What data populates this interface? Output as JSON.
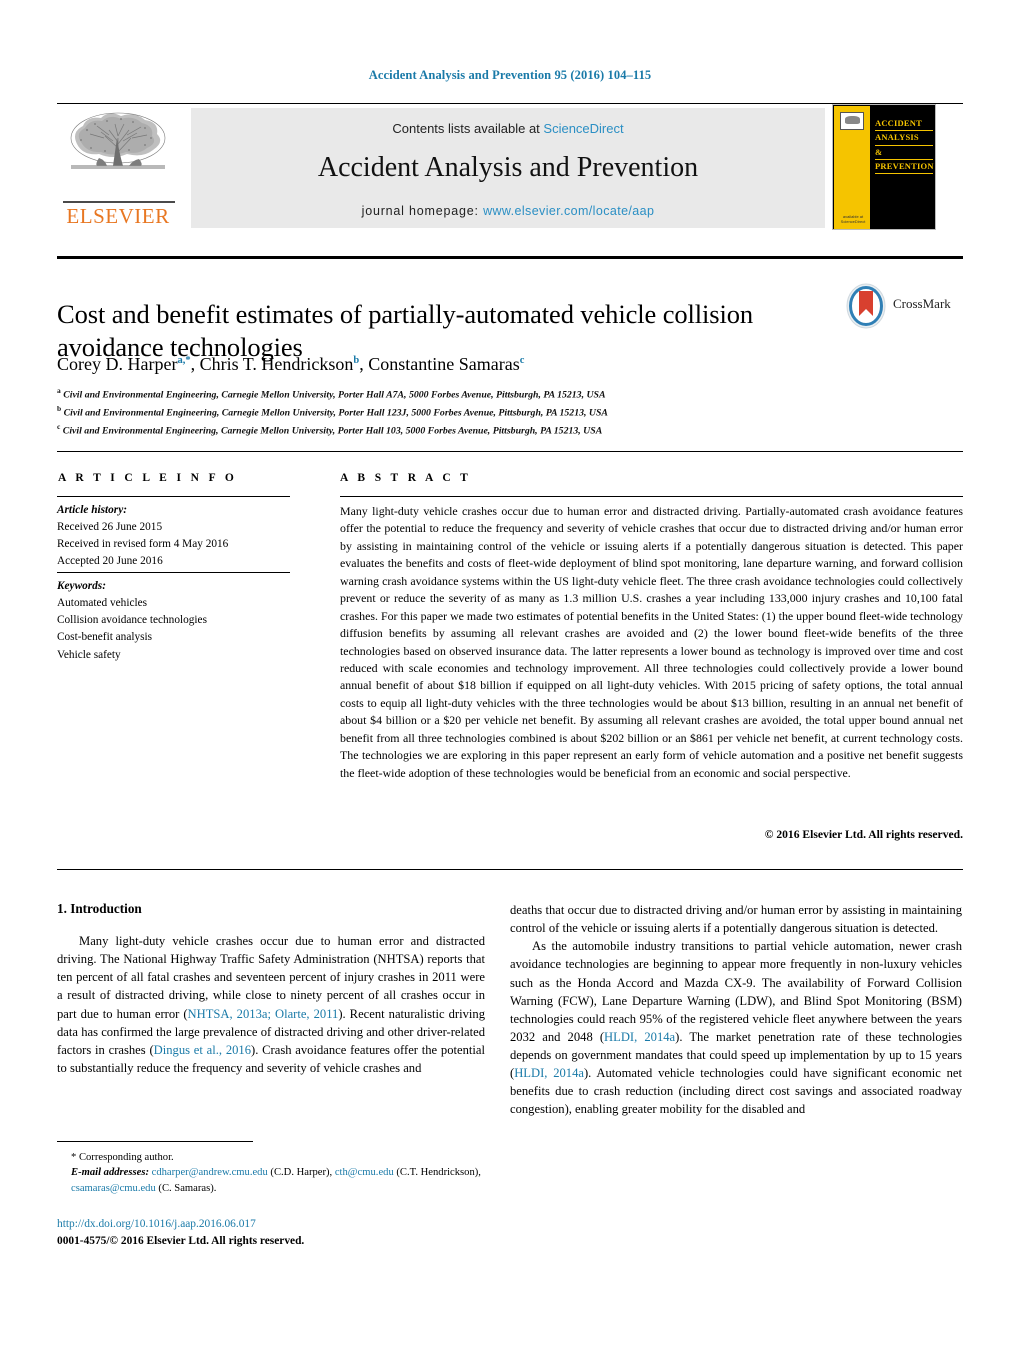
{
  "running_head": "Accident Analysis and Prevention 95 (2016) 104–115",
  "masthead": {
    "publisher_name": "ELSEVIER",
    "contents_prefix": "Contents lists available at ",
    "contents_link": "ScienceDirect",
    "journal_title": "Accident Analysis and Prevention",
    "homepage_label": "journal homepage:",
    "homepage_url": "www.elsevier.com/locate/aap",
    "cover": {
      "line1": "ACCIDENT",
      "line2": "ANALYSIS",
      "line3": "&",
      "line4": "PREVENTION",
      "footer": "available at ScienceDirect"
    }
  },
  "article": {
    "title": "Cost and benefit estimates of partially-automated vehicle collision avoidance technologies",
    "crossmark_label": "CrossMark",
    "authors": [
      {
        "name": "Corey D. Harper",
        "marks": "a,*"
      },
      {
        "name": "Chris T. Hendrickson",
        "marks": "b"
      },
      {
        "name": "Constantine Samaras",
        "marks": "c"
      }
    ],
    "affiliations": [
      {
        "mark": "a",
        "text": "Civil and Environmental Engineering, Carnegie Mellon University, Porter Hall A7A, 5000 Forbes Avenue, Pittsburgh, PA 15213, USA"
      },
      {
        "mark": "b",
        "text": "Civil and Environmental Engineering, Carnegie Mellon University, Porter Hall 123J, 5000 Forbes Avenue, Pittsburgh, PA 15213, USA"
      },
      {
        "mark": "c",
        "text": "Civil and Environmental Engineering, Carnegie Mellon University, Porter Hall 103, 5000 Forbes Avenue, Pittsburgh, PA 15213, USA"
      }
    ]
  },
  "article_info": {
    "heading": "A R T I C L E   I N F O",
    "history_label": "Article history:",
    "history": [
      "Received 26 June 2015",
      "Received in revised form 4 May 2016",
      "Accepted 20 June 2016"
    ],
    "keywords_label": "Keywords:",
    "keywords": [
      "Automated vehicles",
      "Collision avoidance technologies",
      "Cost-benefit analysis",
      "Vehicle safety"
    ]
  },
  "abstract": {
    "heading": "A B S T R A C T",
    "text": "Many light-duty vehicle crashes occur due to human error and distracted driving. Partially-automated crash avoidance features offer the potential to reduce the frequency and severity of vehicle crashes that occur due to distracted driving and/or human error by assisting in maintaining control of the vehicle or issuing alerts if a potentially dangerous situation is detected. This paper evaluates the benefits and costs of fleet-wide deployment of blind spot monitoring, lane departure warning, and forward collision warning crash avoidance systems within the US light-duty vehicle fleet. The three crash avoidance technologies could collectively prevent or reduce the severity of as many as 1.3 million U.S. crashes a year including 133,000 injury crashes and 10,100 fatal crashes. For this paper we made two estimates of potential benefits in the United States: (1) the upper bound fleet-wide technology diffusion benefits by assuming all relevant crashes are avoided and (2) the lower bound fleet-wide benefits of the three technologies based on observed insurance data. The latter represents a lower bound as technology is improved over time and cost reduced with scale economies and technology improvement. All three technologies could collectively provide a lower bound annual benefit of about $18 billion if equipped on all light-duty vehicles. With 2015 pricing of safety options, the total annual costs to equip all light-duty vehicles with the three technologies would be about $13 billion, resulting in an annual net benefit of about $4 billion or a $20 per vehicle net benefit. By assuming all relevant crashes are avoided, the total upper bound annual net benefit from all three technologies combined is about $202 billion or an $861 per vehicle net benefit, at current technology costs. The technologies we are exploring in this paper represent an early form of vehicle automation and a positive net benefit suggests the fleet-wide adoption of these technologies would be beneficial from an economic and social perspective.",
    "copyright": "© 2016 Elsevier Ltd. All rights reserved."
  },
  "body": {
    "section_number_title": "1. Introduction",
    "left_column": {
      "para1_a": "Many light-duty vehicle crashes occur due to human error and distracted driving. The National Highway Traffic Safety Administration (NHTSA) reports that ten percent of all fatal crashes and seventeen percent of injury crashes in 2011 were a result of distracted driving, while close to ninety percent of all crashes occur in part due to human error (",
      "ref1": "NHTSA, 2013a; Olarte, 2011",
      "para1_b": "). Recent naturalistic driving data has confirmed the large prevalence of distracted driving and other driver-related factors in crashes (",
      "ref2": "Dingus et al., 2016",
      "para1_c": "). Crash avoidance features offer the potential to substantially reduce the frequency and severity of vehicle crashes and"
    },
    "right_column": {
      "para1_cont": "deaths that occur due to distracted driving and/or human error by assisting in maintaining control of the vehicle or issuing alerts if a potentially dangerous situation is detected.",
      "para2_a": "As the automobile industry transitions to partial vehicle automation, newer crash avoidance technologies are beginning to appear more frequently in non-luxury vehicles such as the Honda Accord and Mazda CX-9. The availability of Forward Collision Warning (FCW), Lane Departure Warning (LDW), and Blind Spot Monitoring (BSM) technologies could reach 95% of the registered vehicle fleet anywhere between the years 2032 and 2048 (",
      "ref3": "HLDI, 2014a",
      "para2_b": "). The market penetration rate of these technologies depends on government mandates that could speed up implementation by up to 15 years (",
      "ref4": "HLDI, 2014a",
      "para2_c": "). Automated vehicle technologies could have significant economic net benefits due to crash reduction (including direct cost savings and associated roadway congestion), enabling greater mobility for the disabled and"
    }
  },
  "footnotes": {
    "corresponding": "* Corresponding author.",
    "email_label": "E-mail addresses:",
    "email1": "cdharper@andrew.cmu.edu",
    "email1_who": " (C.D. Harper), ",
    "email2": "cth@cmu.edu",
    "email2_who": " (C.T. Hendrickson), ",
    "email3": "csamaras@cmu.edu",
    "email3_who": " (C. Samaras)."
  },
  "doi": {
    "url": "http://dx.doi.org/10.1016/j.aap.2016.06.017",
    "issn_line": "0001-4575/© 2016 Elsevier Ltd. All rights reserved."
  },
  "colors": {
    "link_blue": "#1a7aa8",
    "sciencedirect_blue": "#2b8fc4",
    "elsevier_orange": "#e87722",
    "cover_yellow": "#f5c400"
  }
}
